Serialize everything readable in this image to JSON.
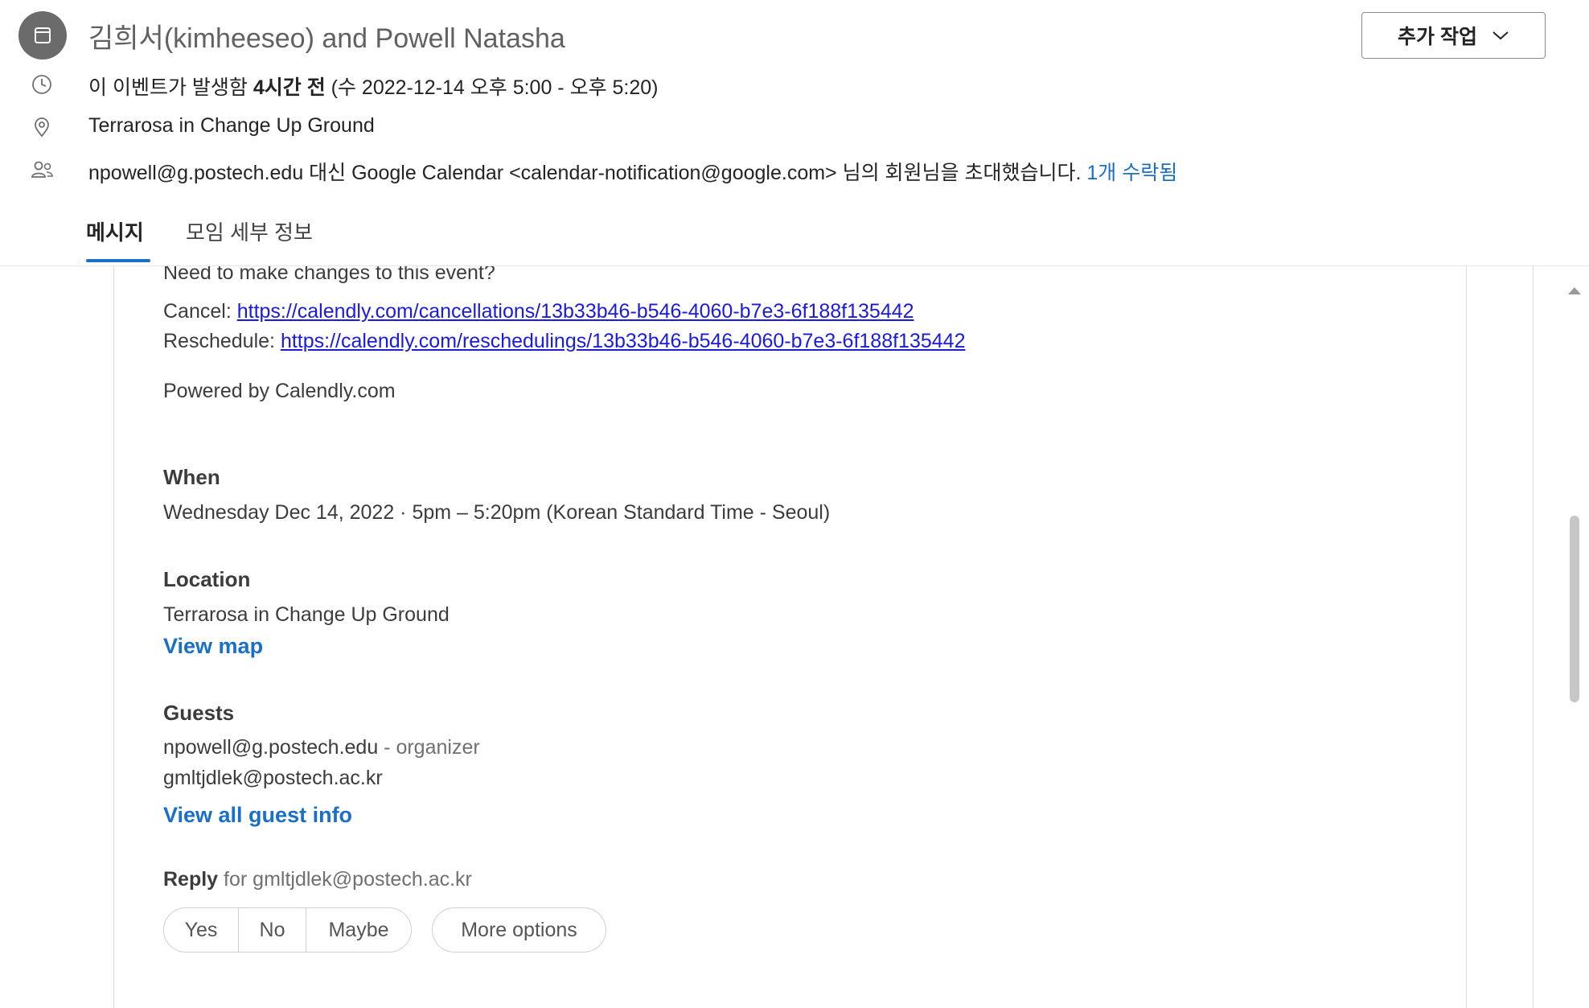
{
  "header": {
    "title": "김희서(kimheeseo) and Powell Natasha",
    "more_actions_label": "추가 작업",
    "time_prefix": "이 이벤트가 발생함 ",
    "time_bold": "4시간 전",
    "time_suffix": " (수 2022-12-14 오후 5:00 - 오후 5:20)",
    "location": "Terrarosa in Change Up Ground",
    "invite_text": "npowell@g.postech.edu 대신 Google Calendar <calendar-notification@google.com> 님의 회원님을 초대했습니다.",
    "accepted_link": "1개 수락됨"
  },
  "tabs": [
    {
      "label": "메시지",
      "active": true
    },
    {
      "label": "모임 세부 정보",
      "active": false
    }
  ],
  "message": {
    "changes_text": "Need to make changes to this event?",
    "cancel_label": "Cancel: ",
    "cancel_url": "https://calendly.com/cancellations/13b33b46-b546-4060-b7e3-6f188f135442",
    "reschedule_label": "Reschedule: ",
    "reschedule_url": "https://calendly.com/reschedulings/13b33b46-b546-4060-b7e3-6f188f135442",
    "powered_by": "Powered by Calendly.com",
    "when_heading": "When",
    "when_value": "Wednesday Dec 14, 2022 · 5pm – 5:20pm (Korean Standard Time - Seoul)",
    "location_heading": "Location",
    "location_value": "Terrarosa in Change Up Ground",
    "view_map": "View map",
    "guests_heading": "Guests",
    "guest1_email": "npowell@g.postech.edu",
    "guest1_role": " - organizer",
    "guest2_email": "gmltjdlek@postech.ac.kr",
    "view_all_guests": "View all guest info",
    "reply_label": "Reply",
    "reply_for": " for gmltjdlek@postech.ac.kr",
    "reply_buttons": [
      "Yes",
      "No",
      "Maybe"
    ],
    "more_options": "More options"
  },
  "colors": {
    "accent": "#1a6fc9",
    "link": "#1a1ae0",
    "badge": "#6b6b6b"
  },
  "icons": [
    "calendar-icon",
    "clock-icon",
    "location-pin-icon",
    "people-icon",
    "chevron-down-icon"
  ]
}
